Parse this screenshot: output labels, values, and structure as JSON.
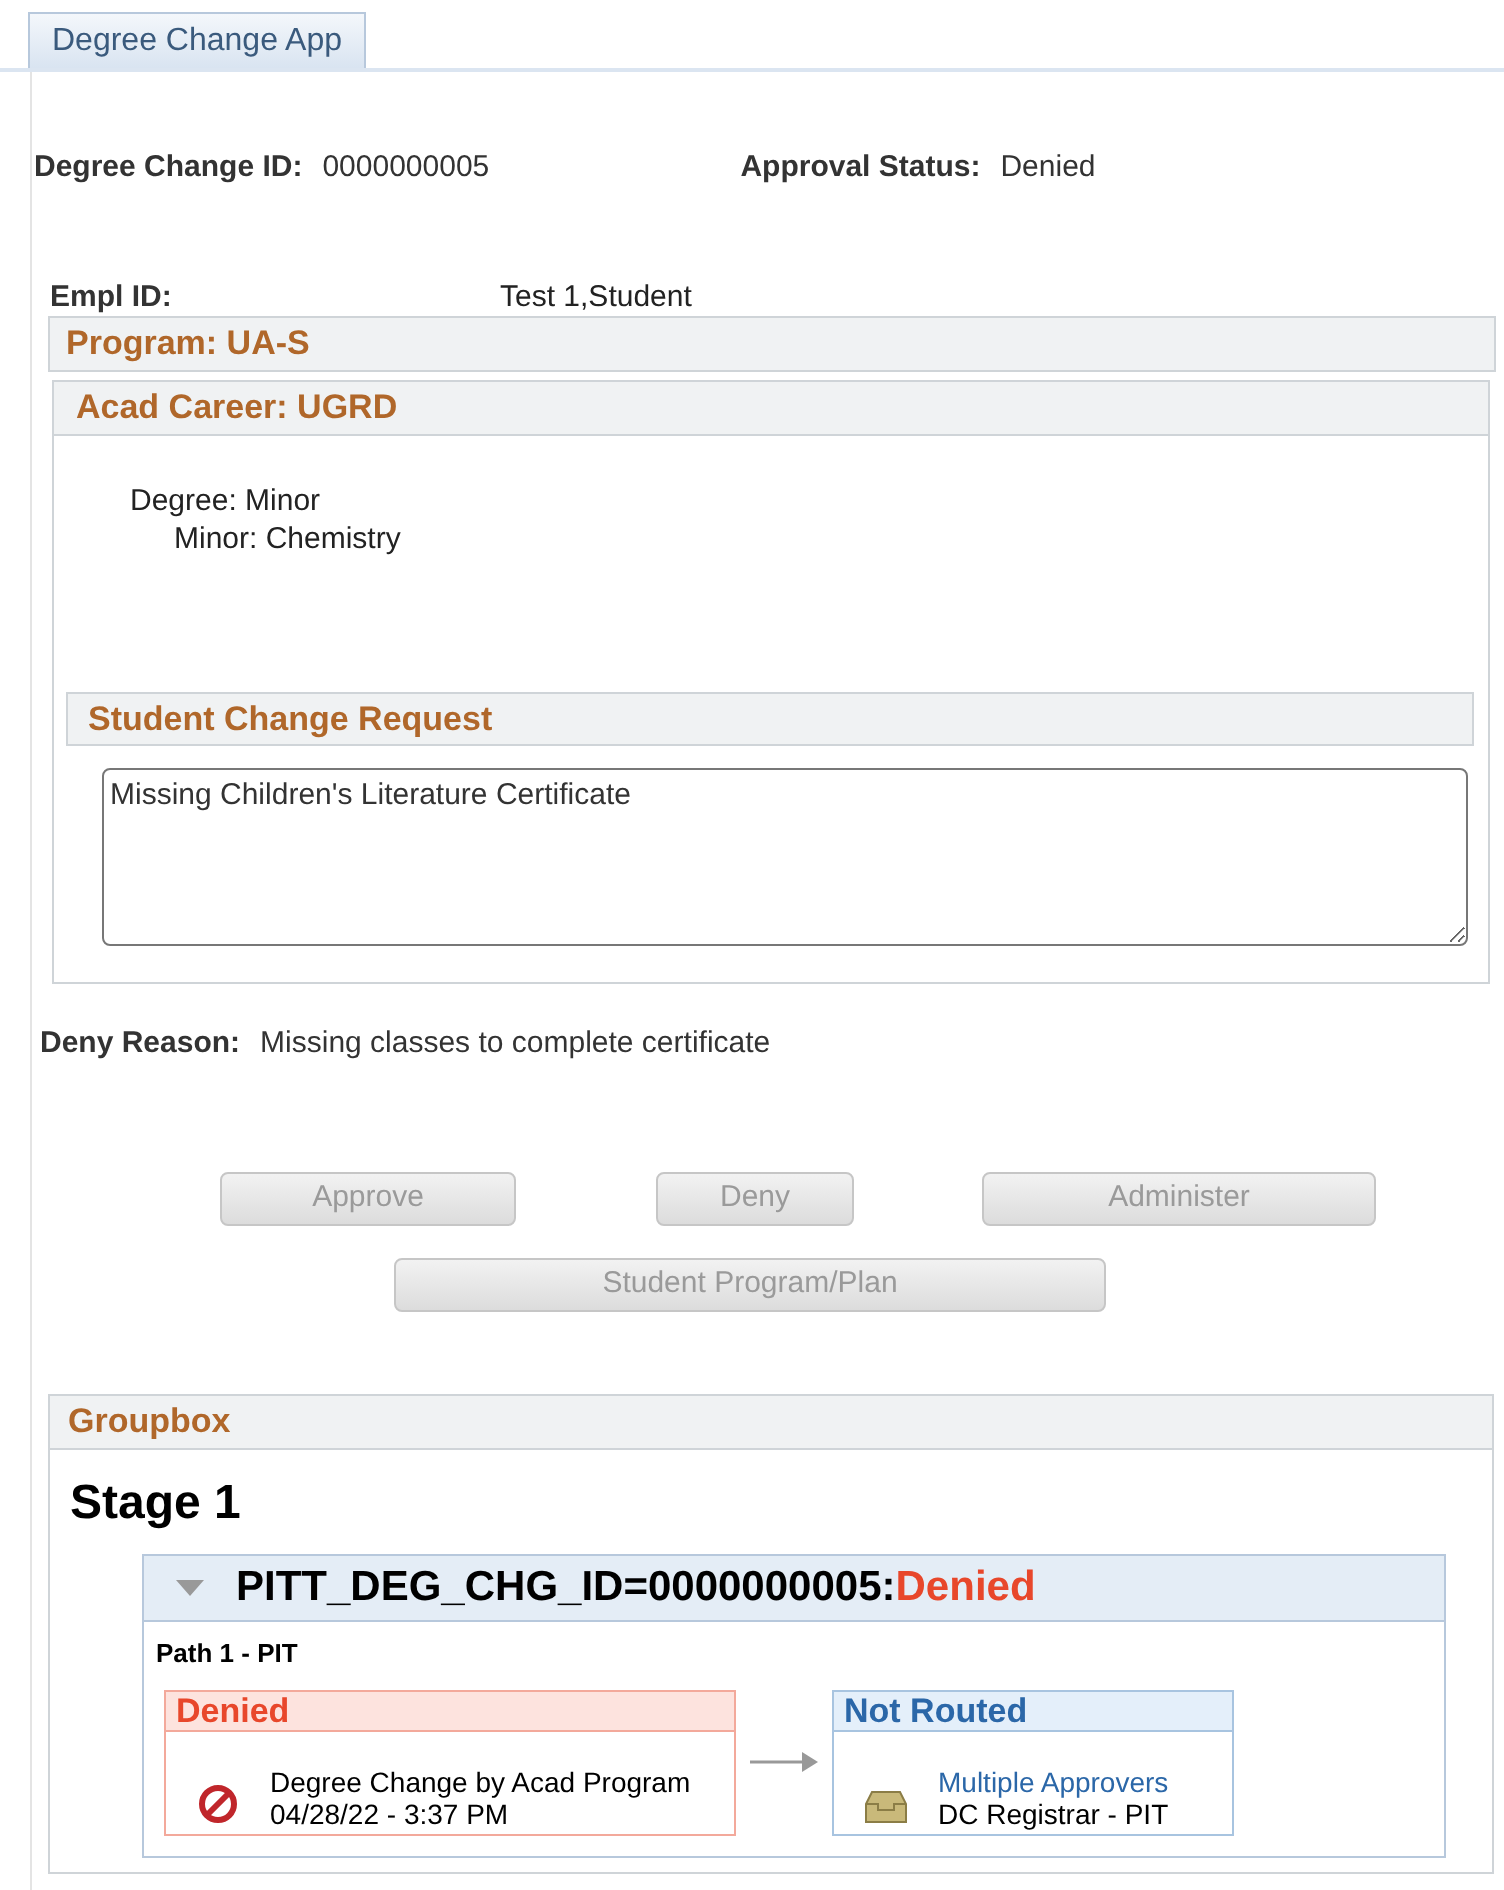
{
  "tabs": [
    {
      "label": "Degree Change App",
      "selected": true
    }
  ],
  "header": {
    "id_label": "Degree Change ID:",
    "id_value": "0000000005",
    "status_label": "Approval Status:",
    "status_value": "Denied"
  },
  "student": {
    "empl_label": "Empl ID:",
    "name": "Test 1,Student"
  },
  "program": {
    "title": "Program: UA-S",
    "career_title": "Acad Career: UGRD",
    "degree": "Degree: Minor",
    "minor": "Minor: Chemistry",
    "request_title": "Student Change Request",
    "request_text": "Missing Children's Literature Certificate"
  },
  "deny": {
    "label": "Deny Reason:",
    "value": "Missing classes to complete certificate"
  },
  "buttons": [
    {
      "label": "Approve",
      "disabled": true
    },
    {
      "label": "Deny",
      "disabled": true
    },
    {
      "label": "Administer",
      "disabled": true
    },
    {
      "label": "Student Program/Plan",
      "disabled": true
    }
  ],
  "groupbox": {
    "title": "Groupbox",
    "stage": "Stage 1",
    "process": "PITT_DEG_CHG_ID=0000000005:",
    "process_status": "Denied",
    "expanded": true,
    "path": "Path 1 - PIT",
    "steps": [
      {
        "kind": "denied",
        "status": "Denied",
        "line1": "Degree Change by Acad Program",
        "line2": "04/28/22 - 3:37 PM"
      },
      {
        "kind": "pending",
        "status": "Not Routed",
        "line1": "Multiple Approvers",
        "line2": "DC Registrar - PIT"
      }
    ]
  }
}
